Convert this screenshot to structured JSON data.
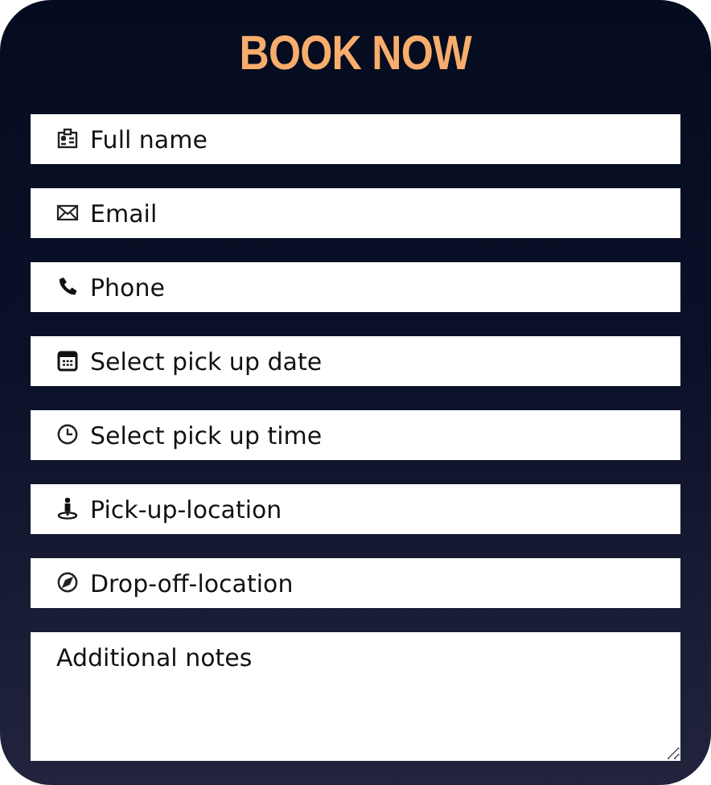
{
  "title": "BOOK NOW",
  "fields": [
    {
      "kind": "input",
      "placeholder": "Full name"
    },
    {
      "kind": "input",
      "placeholder": "Email"
    },
    {
      "kind": "input",
      "placeholder": "Phone"
    },
    {
      "kind": "input",
      "placeholder": "Select pick up date"
    },
    {
      "kind": "input",
      "placeholder": "Select pick up time"
    },
    {
      "kind": "input",
      "placeholder": "Pick-up-location"
    },
    {
      "kind": "input",
      "placeholder": "Drop-off-location"
    },
    {
      "kind": "textarea",
      "placeholder": "Additional notes"
    }
  ]
}
